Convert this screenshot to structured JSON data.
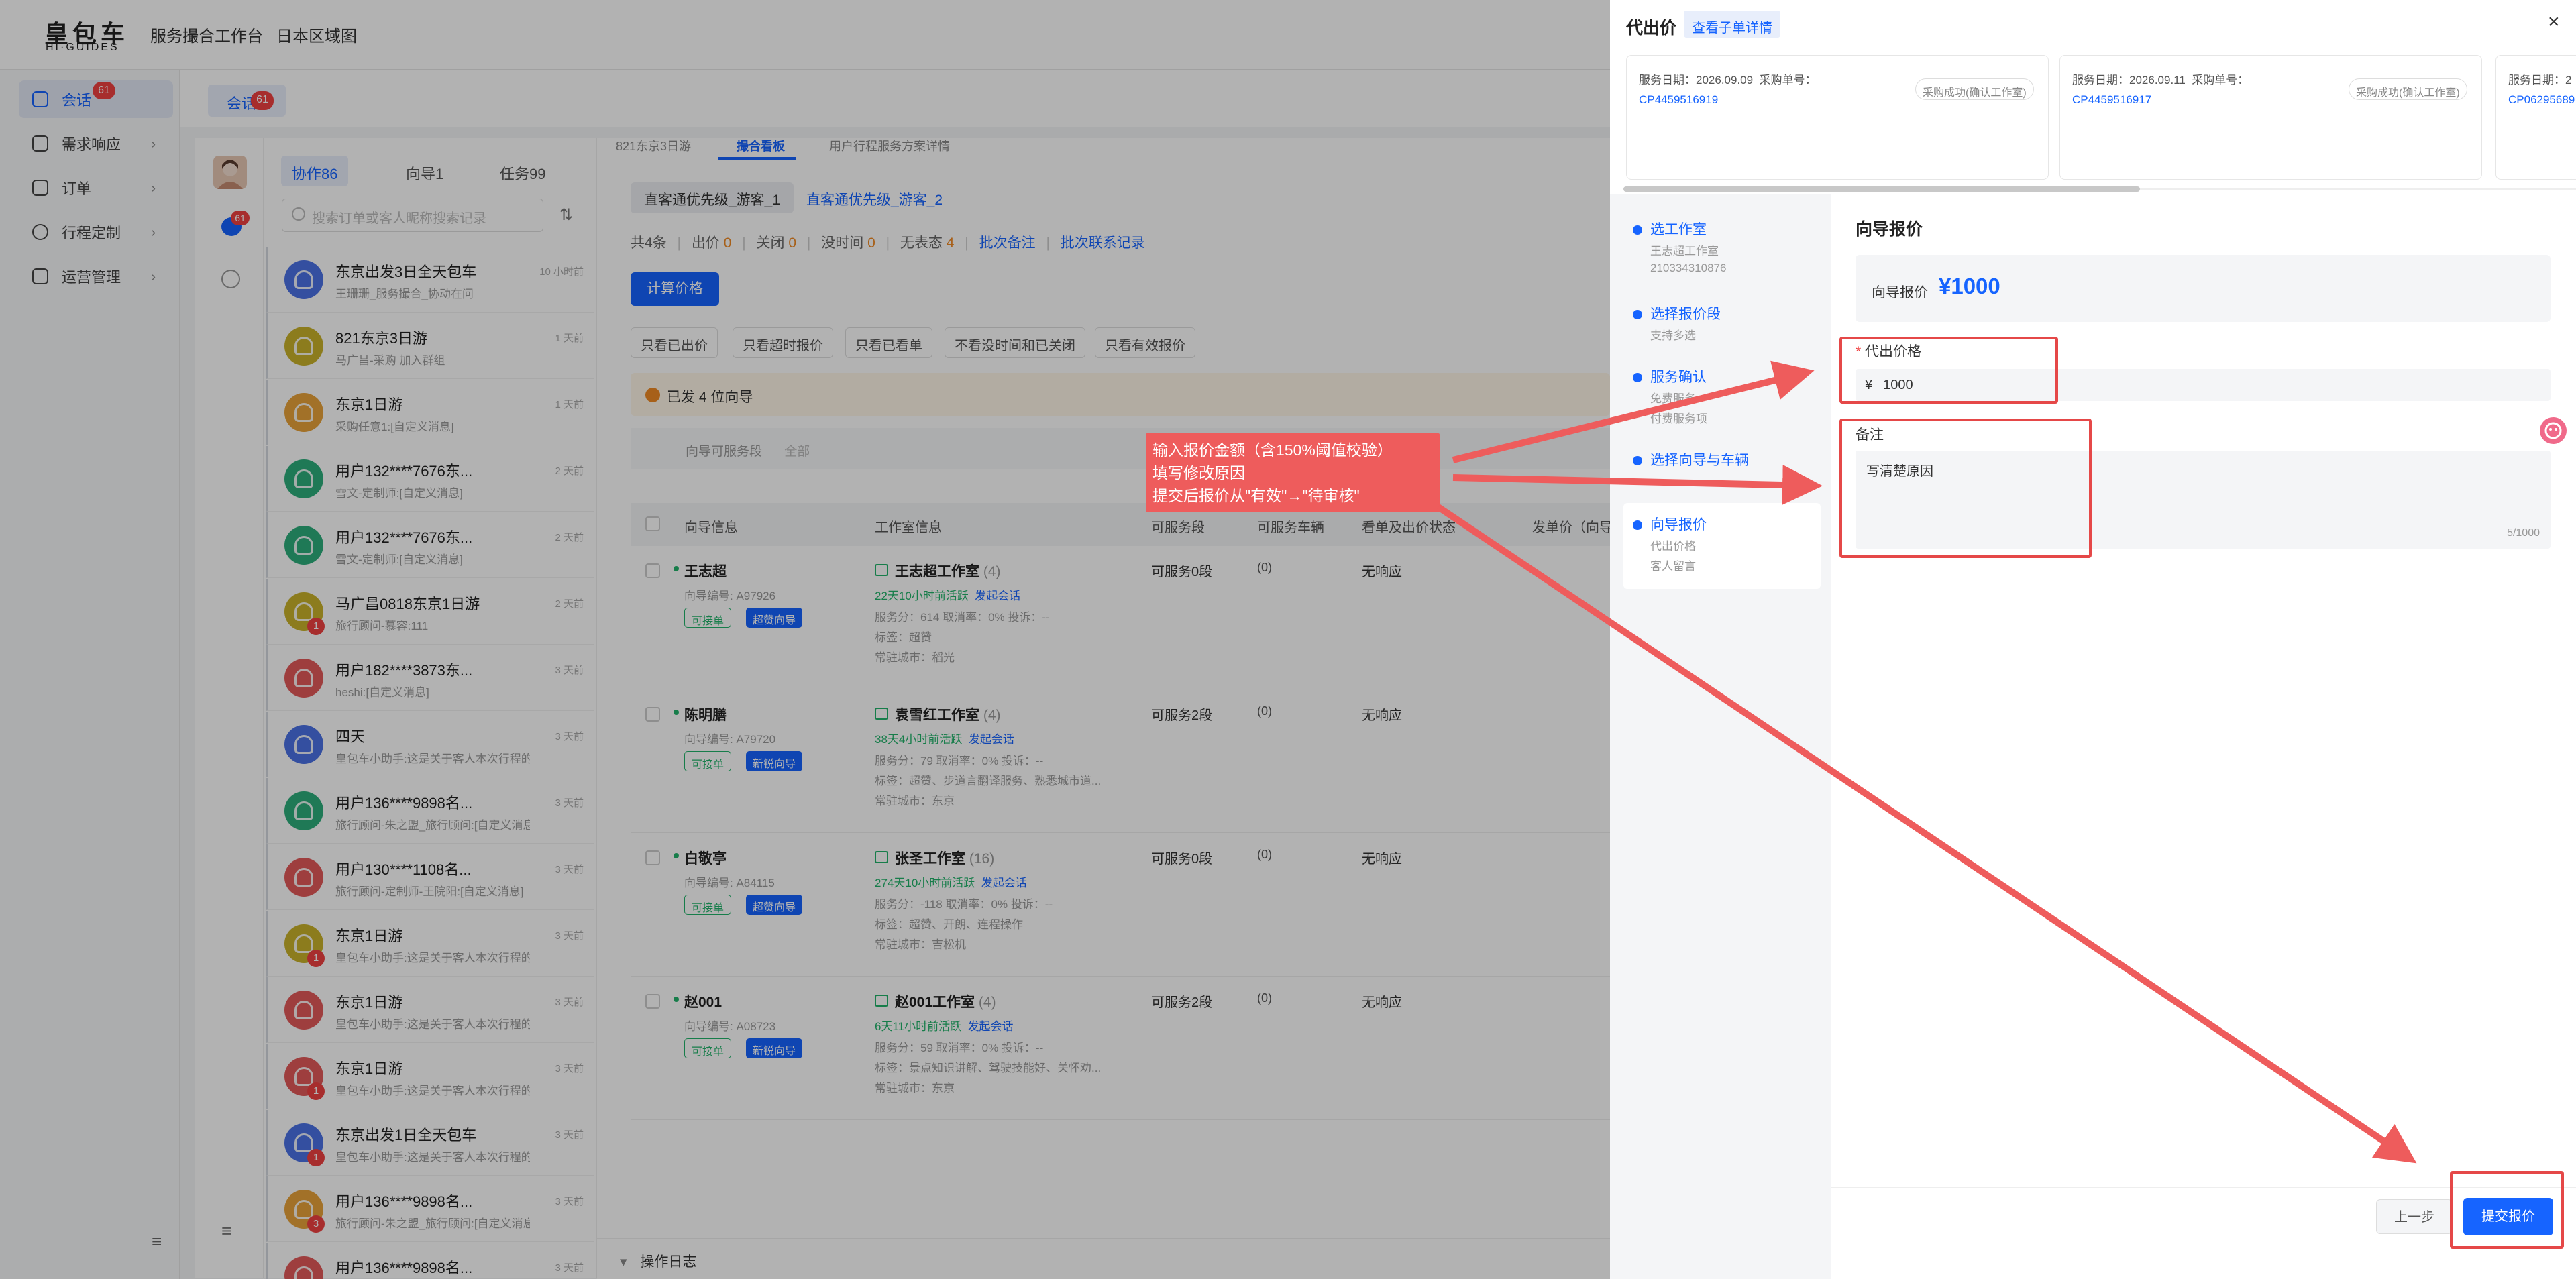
{
  "brand": {
    "cn": "皇包车",
    "en": "HI·GUIDES"
  },
  "topnav": [
    "服务撮合工作台",
    "日本区域图"
  ],
  "sidebar": {
    "items": [
      {
        "label": "会话",
        "badge": "61"
      },
      {
        "label": "需求响应"
      },
      {
        "label": "订单"
      },
      {
        "label": "行程定制"
      },
      {
        "label": "运营管理"
      }
    ],
    "fold_icon": "≡"
  },
  "tabbar": {
    "session_label": "会话",
    "session_badge": "61"
  },
  "leftcol": {
    "chat_badge": "61"
  },
  "list": {
    "subtabs": [
      "协作86",
      "向导1",
      "任务99"
    ],
    "search_placeholder": "搜索订单或客人昵称搜索记录",
    "conversations": [
      {
        "title": "东京出发3日全天包车",
        "sub": "王珊珊_服务撮合_协动在问",
        "time": "10 小时前",
        "color": "#4b72e6",
        "badge": ""
      },
      {
        "title": "821东京3日游",
        "sub": "马广昌-采购 加入群组",
        "time": "1 天前",
        "color": "#c9b22a",
        "badge": ""
      },
      {
        "title": "东京1日游",
        "sub": "采购任意1:[自定义消息]",
        "time": "1 天前",
        "color": "#e8a33a",
        "badge": ""
      },
      {
        "title": "用户132****7676东...",
        "sub": "雪文-定制师:[自定义消息]",
        "time": "2 天前",
        "color": "#2dae7c",
        "badge": ""
      },
      {
        "title": "用户132****7676东...",
        "sub": "雪文-定制师:[自定义消息]",
        "time": "2 天前",
        "color": "#2dae7c",
        "badge": ""
      },
      {
        "title": "马广昌0818东京1日游",
        "sub": "旅行顾问-慕容:111",
        "time": "2 天前",
        "color": "#c9b22a",
        "badge": "1"
      },
      {
        "title": "用户182****3873东...",
        "sub": "heshi:[自定义消息]",
        "time": "3 天前",
        "color": "#e35a5a",
        "badge": ""
      },
      {
        "title": "四天",
        "sub": "皇包车小助手:这是关于客人本次行程的协作...",
        "time": "3 天前",
        "color": "#4b72e6",
        "badge": ""
      },
      {
        "title": "用户136****9898名...",
        "sub": "旅行顾问-朱之盟_旅行顾问:[自定义消息]",
        "time": "3 天前",
        "color": "#2dae7c",
        "badge": ""
      },
      {
        "title": "用户130****1108名...",
        "sub": "旅行顾问-定制师-王院阳:[自定义消息]",
        "time": "3 天前",
        "color": "#e35a5a",
        "badge": ""
      },
      {
        "title": "东京1日游",
        "sub": "皇包车小助手:这是关于客人本次行程的协作...",
        "time": "3 天前",
        "color": "#c9b22a",
        "badge": "1"
      },
      {
        "title": "东京1日游",
        "sub": "皇包车小助手:这是关于客人本次行程的协作...",
        "time": "3 天前",
        "color": "#e35a5a",
        "badge": ""
      },
      {
        "title": "东京1日游",
        "sub": "皇包车小助手:这是关于客人本次行程的协作...",
        "time": "3 天前",
        "color": "#e35a5a",
        "badge": "1"
      },
      {
        "title": "东京出发1日全天包车",
        "sub": "皇包车小助手:这是关于客人本次行程的协作...",
        "time": "3 天前",
        "color": "#4b72e6",
        "badge": "1"
      },
      {
        "title": "用户136****9898名...",
        "sub": "旅行顾问-朱之盟_旅行顾问:[自定义消息]",
        "time": "3 天前",
        "color": "#e8a33a",
        "badge": "3"
      },
      {
        "title": "用户136****9898名...",
        "sub": "",
        "time": "3 天前",
        "color": "#e35a5a",
        "badge": ""
      }
    ]
  },
  "main": {
    "breadcrumbs": [
      "821东京3日游",
      "撮合看板",
      "用户行程服务方案详情"
    ],
    "subtabs": [
      "直客通优先级_游客_1",
      "直客通优先级_游客_2"
    ],
    "stats": {
      "total": "共4条",
      "sep": "|",
      "out_label": "出价",
      "out": "0",
      "closed_label": "关闭",
      "closed": "0",
      "notime_label": "没时间",
      "notime": "0",
      "none_label": "无表态",
      "none": "4",
      "batch_remark": "批次备注",
      "batch_contact": "批次联系记录"
    },
    "calc_button": "计算价格",
    "filters": [
      "只看已出价",
      "只看超时报价",
      "只看已看单",
      "不看没时间和已关闭",
      "只看有效报价"
    ],
    "warning": "已发 4 位向导",
    "filter_box_label": "向导可服务段",
    "filter_box_value": "全部",
    "columns": [
      "向导信息",
      "工作室信息",
      "可服务段",
      "可服务车辆",
      "看单及出价状态",
      "发单价（向导"
    ],
    "rows": [
      {
        "name": "王志超",
        "no": "向导编号: A97926",
        "tag1": "可接单",
        "tag2": "超赞向导",
        "studio": "王志超工作室",
        "count": "(4)",
        "l1": "22天10小时前活跃",
        "l1link": "发起会话",
        "l2": "服务分：614   取消率：0%   投诉：--",
        "l3": "标签：超赞",
        "l4": "常驻城市：稻光",
        "seg": "可服务0段",
        "veh": "(0)",
        "status": "无响应"
      },
      {
        "name": "陈明膳",
        "no": "向导编号: A79720",
        "tag1": "可接单",
        "tag2": "新锐向导",
        "studio": "袁雪红工作室",
        "count": "(4)",
        "l1": "38天4小时前活跃",
        "l1link": "发起会话",
        "l2": "服务分：79   取消率：0%   投诉：--",
        "l3": "标签：超赞、步道言翻译服务、熟悉城市道...",
        "l4": "常驻城市：东京",
        "seg": "可服务2段",
        "veh": "(0)",
        "status": "无响应"
      },
      {
        "name": "白敬亭",
        "no": "向导编号: A84115",
        "tag1": "可接单",
        "tag2": "超赞向导",
        "studio": "张圣工作室",
        "count": "(16)",
        "l1": "274天10小时前活跃",
        "l1link": "发起会话",
        "l2": "服务分：-118   取消率：0%   投诉：--",
        "l3": "标签：超赞、开朗、连程操作",
        "l4": "常驻城市：吉松机",
        "seg": "可服务0段",
        "veh": "(0)",
        "status": "无响应"
      },
      {
        "name": "赵001",
        "no": "向导编号: A08723",
        "tag1": "可接单",
        "tag2": "新锐向导",
        "studio": "赵001工作室",
        "count": "(4)",
        "l1": "6天11小时前活跃",
        "l1link": "发起会话",
        "l2": "服务分：59   取消率：0%   投诉：--",
        "l3": "标签：景点知识讲解、驾驶技能好、关怀劝...",
        "l4": "常驻城市：东京",
        "seg": "可服务2段",
        "veh": "(0)",
        "status": "无响应"
      }
    ],
    "oplog": "操作日志"
  },
  "drawer": {
    "title": "代出价",
    "link": "查看子单详情",
    "close": "×",
    "orders": [
      {
        "date_label": "服务日期：",
        "date": "2026.09.09",
        "no_label": "采购单号：",
        "no": "CP4459516919",
        "status": "采购成功(确认工作室)"
      },
      {
        "date_label": "服务日期：",
        "date": "2026.09.11",
        "no_label": "采购单号：",
        "no": "CP4459516917",
        "status": "采购成功(确认工作室)"
      },
      {
        "date_label": "服务日期：",
        "date": "2",
        "no_label": "",
        "no": "CP06295689",
        "status": ""
      }
    ],
    "steps": [
      {
        "name": "选工作室",
        "lines": [
          "王志超工作室",
          "210334310876"
        ]
      },
      {
        "name": "选择报价段",
        "lines": [
          "支持多选"
        ]
      },
      {
        "name": "服务确认",
        "lines": [
          "免费服务",
          "付费服务项"
        ]
      },
      {
        "name": "选择向导与车辆",
        "lines": []
      },
      {
        "name": "向导报价",
        "lines": [
          "代出价格",
          "客人留言"
        ]
      }
    ],
    "form": {
      "title": "向导报价",
      "guide_price_label": "向导报价",
      "guide_price": "¥1000",
      "proxy_label": "代出价格",
      "required_mark": "*",
      "currency": "¥",
      "proxy_value": "1000",
      "remark_label": "备注",
      "remark_value": "写清楚原因",
      "remark_count": "5/1000"
    },
    "prev_button": "上一步",
    "submit_button": "提交报价"
  },
  "annotation": {
    "lines": [
      "输入报价金额（含150%阈值校验）",
      "填写修改原因",
      "提交后报价从\"有效\"→\"待审核\""
    ],
    "color": "#e54848"
  }
}
